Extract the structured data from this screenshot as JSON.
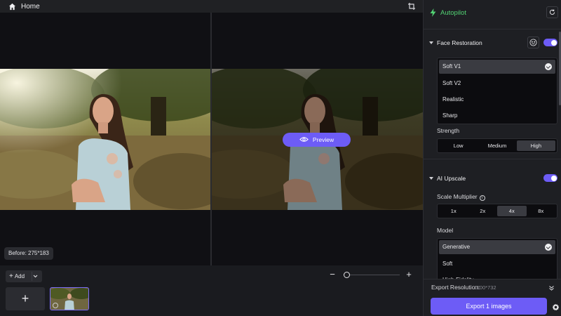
{
  "topbar": {
    "home_label": "Home"
  },
  "canvas": {
    "before_badge": "Before: 275*183",
    "preview_label": "Preview"
  },
  "bottom": {
    "add_label": "Add",
    "zoom_level": 0.05
  },
  "panel": {
    "autopilot_label": "Autopilot",
    "face_restoration": {
      "title": "Face Restoration",
      "enabled": true,
      "options": [
        "Soft V1",
        "Soft V2",
        "Realistic",
        "Sharp"
      ],
      "selected": "Soft V1",
      "strength_label": "Strength",
      "strength_options": [
        "Low",
        "Medium",
        "High"
      ],
      "strength_selected": "High"
    },
    "ai_upscale": {
      "title": "AI Upscale",
      "enabled": true,
      "scale_label": "Scale Multiplier",
      "scale_options": [
        "1x",
        "2x",
        "4x",
        "8x"
      ],
      "scale_selected": "4x",
      "model_label": "Model",
      "model_options": [
        "Generative",
        "Soft",
        "High-Fidelity"
      ],
      "model_selected": "Generative"
    },
    "footer": {
      "export_resolution_label": "Export Resolution:",
      "export_resolution_value": "1100*732",
      "export_button": "Export 1 images"
    }
  },
  "colors": {
    "accent": "#6d5cf6",
    "autopilot_green": "#52d273",
    "panel_bg": "#1e1f23",
    "canvas_bg": "#101014"
  }
}
